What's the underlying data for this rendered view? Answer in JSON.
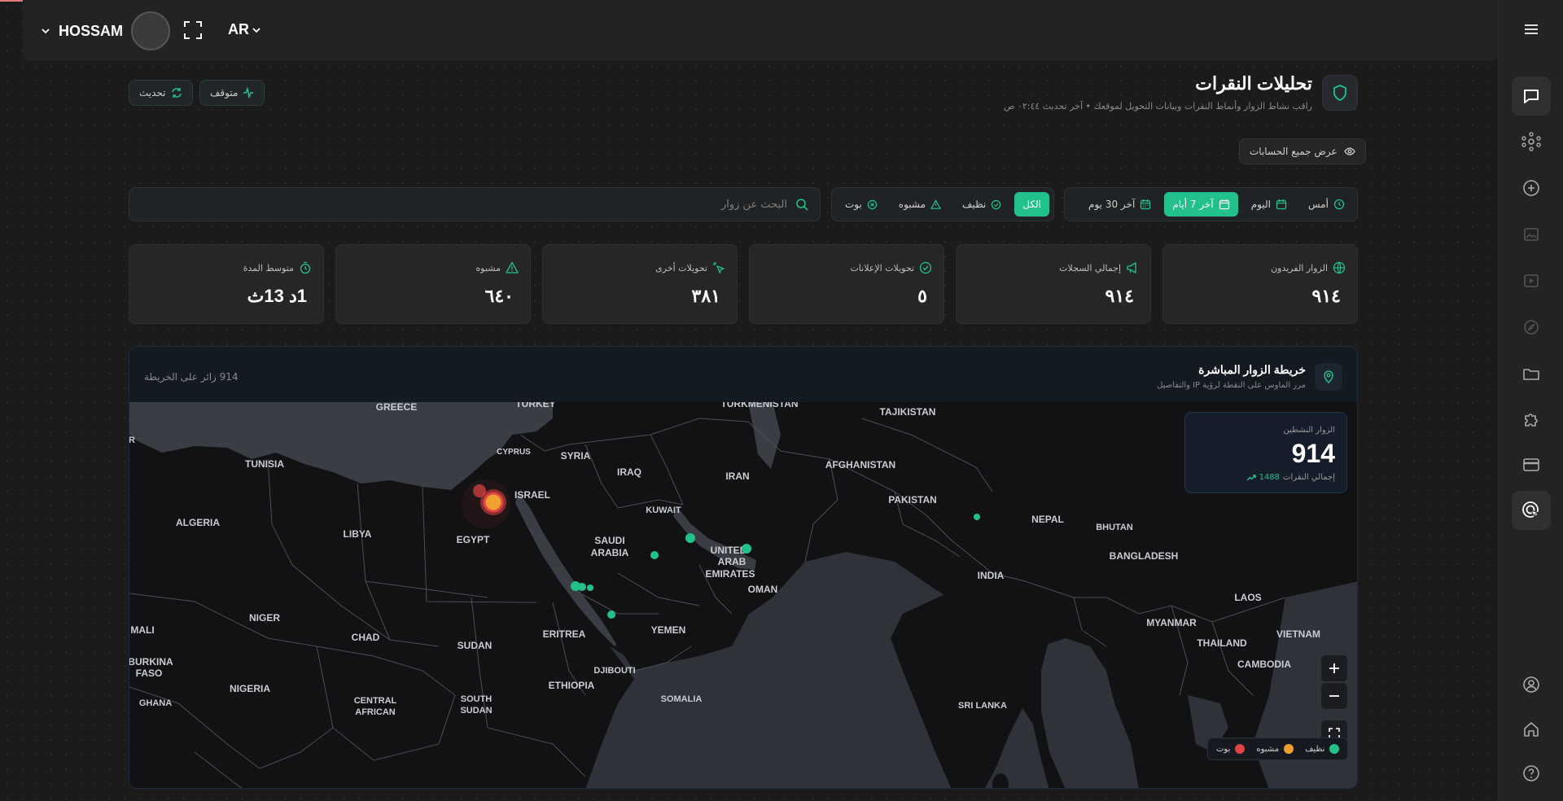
{
  "topbar": {
    "user_name": "HOSSAM",
    "language": "AR"
  },
  "header": {
    "title": "تحليلات النقرات",
    "subtitle": "راقب نشاط الزوار وأنماط النقرات وبيانات التحويل لموقعك • آخر تحديث ٠٢:٤٤ ص",
    "refresh_label": "تحديث",
    "paused_label": "متوقف",
    "all_accounts_label": "عرض جميع الحسابات"
  },
  "filters": {
    "search_placeholder": "البحث عن زوار",
    "types": [
      {
        "label": "الكل",
        "active": true,
        "icon": ""
      },
      {
        "label": "نظيف",
        "active": false,
        "icon": "check-circle-icon"
      },
      {
        "label": "مشبوه",
        "active": false,
        "icon": "warning-triangle-icon"
      },
      {
        "label": "بوت",
        "active": false,
        "icon": "x-circle-icon"
      }
    ],
    "ranges": [
      {
        "label": "أمس",
        "active": false,
        "icon": "clock-icon"
      },
      {
        "label": "اليوم",
        "active": false,
        "icon": "calendar-icon"
      },
      {
        "label": "آخر 7 أيام",
        "active": true,
        "icon": "calendar-icon"
      },
      {
        "label": "آخر 30 يوم",
        "active": false,
        "icon": "calendar-icon"
      }
    ]
  },
  "stats": [
    {
      "label": "الزوار الفريدون",
      "value": "٩١٤",
      "icon": "globe-icon"
    },
    {
      "label": "إجمالي السجلات",
      "value": "٩١٤",
      "icon": "megaphone-icon"
    },
    {
      "label": "تحويلات الإعلانات",
      "value": "٥",
      "icon": "check-circle-icon"
    },
    {
      "label": "تحويلات أخرى",
      "value": "٣٨١",
      "icon": "cursor-click-icon"
    },
    {
      "label": "مشبوه",
      "value": "٦٤٠",
      "icon": "warning-triangle-icon"
    },
    {
      "label": "متوسط المدة",
      "value": "1د 13ث",
      "icon": "timer-icon"
    }
  ],
  "map": {
    "title": "خريطة الزوار المباشرة",
    "subtitle": "مرر الماوس على النقطة لرؤية IP والتفاصيل",
    "visitor_count_label": "914 زائر على الخريطة",
    "active_visitors_label": "الزوار النشطين",
    "active_visitors_value": "914",
    "total_clicks_value": "1488",
    "total_clicks_label": "إجمالي النقرات",
    "legend": [
      {
        "label": "نظيف",
        "color": "#22c08a"
      },
      {
        "label": "مشبوه",
        "color": "#f0a030"
      },
      {
        "label": "بوت",
        "color": "#e04444"
      }
    ],
    "country_labels": [
      "GREECE",
      "TURKEY",
      "TURKMENISTAN",
      "TAJIKISTAN",
      "CYPRUS",
      "SYRIA",
      "TUNISIA",
      "IRAQ",
      "IRAN",
      "AFGHANISTAN",
      "ISRAEL",
      "PAKISTAN",
      "KUWAIT",
      "ALGERIA",
      "LIBYA",
      "EGYPT",
      "SAUDI",
      "ARABIA",
      "UNITED",
      "ARAB",
      "EMIRATES",
      "NEPAL",
      "BHUTAN",
      "BANGLADESH",
      "INDIA",
      "OMAN",
      "LAOS",
      "NIGER",
      "CHAD",
      "MYANMAR",
      "MALI",
      "ERITREA",
      "YEMEN",
      "SUDAN",
      "THAILAND",
      "VIETNAM",
      "CAMBODIA",
      "BURKINA",
      "FASO",
      "DJIBOUTI",
      "ETHIOPIA",
      "NIGERIA",
      "GHANA",
      "CENTRAL",
      "AFRICAN",
      "SOUTH",
      "SUDAN",
      "SOMALIA",
      "SRI LANKA",
      "R"
    ],
    "markers": [
      {
        "name": "egypt-cluster-suspicious",
        "status": "suspicious"
      },
      {
        "name": "egypt-cluster-bot",
        "status": "bot"
      },
      {
        "name": "kuwait-visitor",
        "status": "clean"
      },
      {
        "name": "riyadh-visitor",
        "status": "clean"
      },
      {
        "name": "uae-visitor",
        "status": "clean"
      },
      {
        "name": "jeddah-visitor",
        "status": "clean"
      },
      {
        "name": "jeddah-visitor-2",
        "status": "clean"
      },
      {
        "name": "jizan-visitor",
        "status": "clean"
      },
      {
        "name": "india-visitor",
        "status": "clean"
      }
    ]
  }
}
